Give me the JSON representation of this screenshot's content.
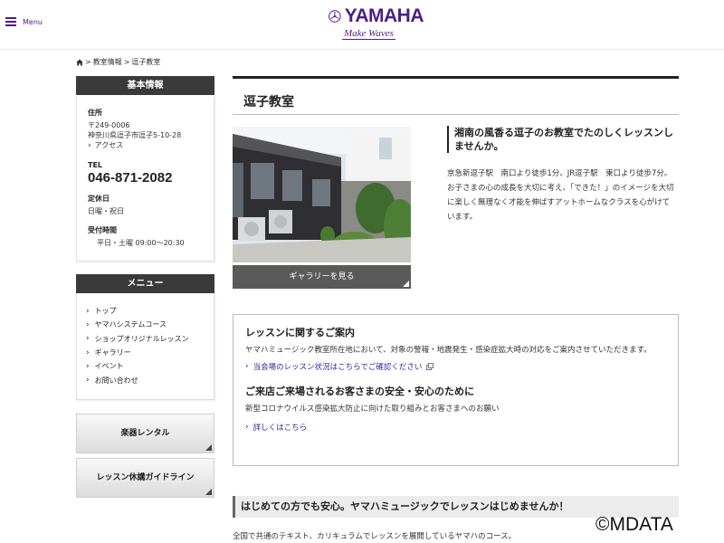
{
  "header": {
    "menu_label": "Menu",
    "logo_text": "YAMAHA",
    "logo_tagline": "Make Waves",
    "brand_color": "#4b1e84"
  },
  "breadcrumb": {
    "home_icon": "home-icon",
    "items": [
      "教室情報",
      "逗子教室"
    ],
    "separator": ">"
  },
  "sidebar": {
    "basic_info": {
      "heading": "基本情報",
      "address_label": "住所",
      "postal_code": "〒249-0006",
      "address": "神奈川県逗子市逗子5-10-28",
      "access_link": "アクセス",
      "tel_label": "TEL",
      "tel": "046-871-2082",
      "closed_label": "定休日",
      "closed_days": "日曜・祝日",
      "hours_label": "受付時間",
      "hours": "平日・土曜 09:00～20:30"
    },
    "menu": {
      "heading": "メニュー",
      "items": [
        "トップ",
        "ヤマハシステムコース",
        "ショップオリジナルレッスン",
        "ギャラリー",
        "イベント",
        "お問い合わせ"
      ]
    },
    "buttons": {
      "rental": "楽器レンタル",
      "guideline": "レッスン休講ガイドライン"
    }
  },
  "main": {
    "title": "逗子教室",
    "gallery_button": "ギャラリーを見る",
    "catch_copy": "湘南の風香る逗子のお教室でたのしくレッスンしませんか。",
    "description": "京急新逗子駅　南口より徒歩1分、JR逗子駅　東口より徒歩7分。お子さまの心の成長を大切に考え、「できた！」のイメージを大切に楽しく無理なく才能を伸ばすアットホームなクラスを心がけています。",
    "notice": {
      "heading1": "レッスンに関するご案内",
      "text1": "ヤマハミュージック教室所在地において、対象の警報・地震発生・感染症拡大時の対応をご案内させていただきます。",
      "link1": "当会場のレッスン状況はこちらでご確認ください",
      "heading2": "ご来店ご来場されるお客さまの安全・安心のために",
      "text2": "新型コロナウイルス感染拡大防止に向けた取り組みとお客さまへのお願い",
      "link2": "詳しくはこちら"
    },
    "promo": "はじめての方でも安心。ヤマハミュージックでレッスンはじめませんか！",
    "footer_text": "全国で共通のテキスト、カリキュラムでレッスンを展開しているヤマハのコース。"
  },
  "watermark": "©MDATA"
}
